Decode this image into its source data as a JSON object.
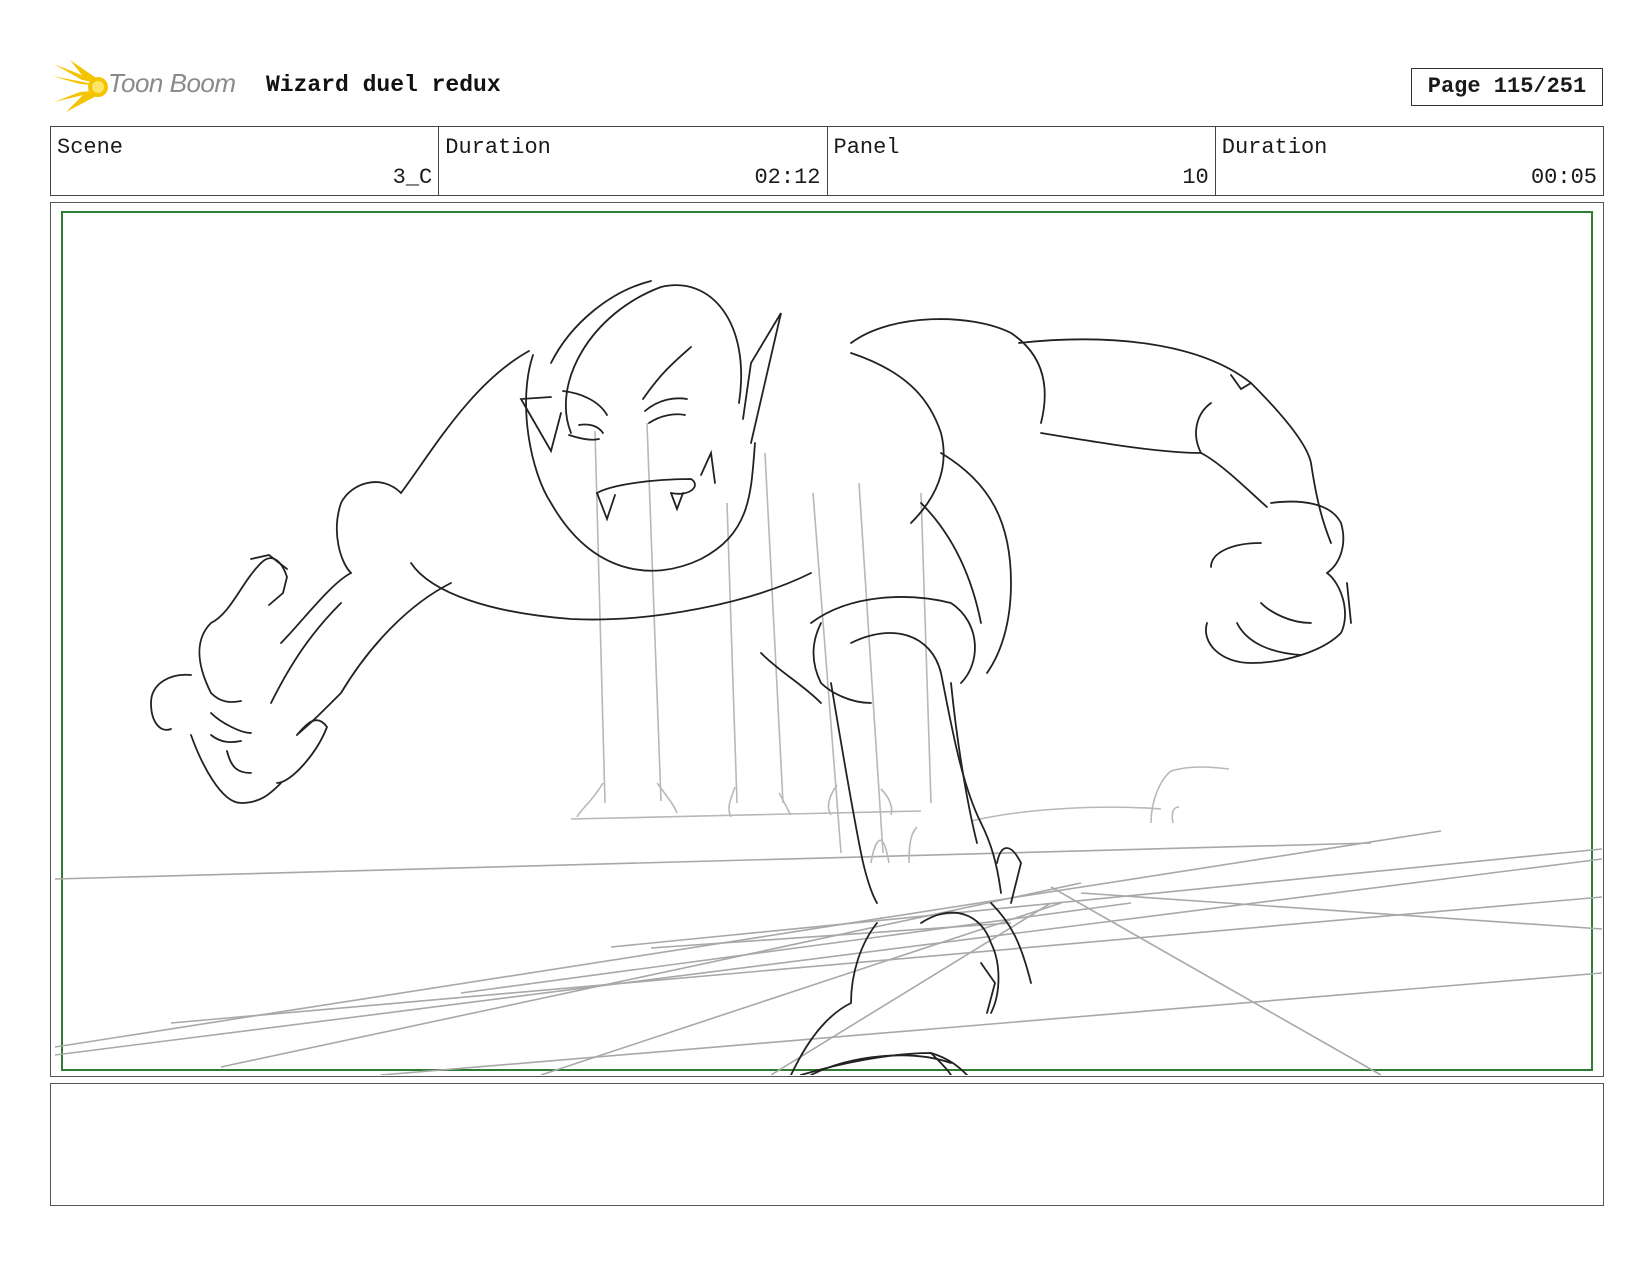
{
  "header": {
    "logo_text": "Toon Boom",
    "title": "Wizard duel redux",
    "page_label": "Page 115/251"
  },
  "info": [
    {
      "label": "Scene",
      "value": "3_C"
    },
    {
      "label": "Duration",
      "value": "02:12"
    },
    {
      "label": "Panel",
      "value": "10"
    },
    {
      "label": "Duration",
      "value": "00:05"
    }
  ],
  "panel": {
    "safe_frame_color": "#2e7d32",
    "sketch_color": "#222222",
    "guide_color": "#a8a8a8",
    "content": "pencil sketch of a crouching goblin reaching forward with clawed hands"
  },
  "notes": {
    "text": ""
  },
  "colors": {
    "logo_yellow": "#f5c400",
    "logo_text": "#8a8a8a",
    "border": "#444444"
  }
}
